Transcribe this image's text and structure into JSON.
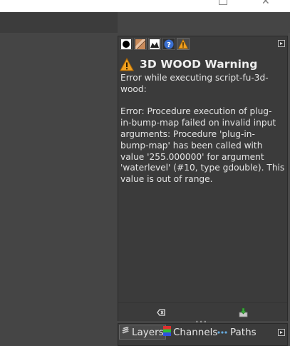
{
  "window": {
    "maximize_icon": "maximize-icon",
    "close_icon": "close-icon"
  },
  "dock": {
    "tabs": [
      {
        "icon": "brush-icon",
        "active": false
      },
      {
        "icon": "pattern-icon",
        "active": false
      },
      {
        "icon": "gradient-icon",
        "active": false
      },
      {
        "icon": "help-icon",
        "active": false
      },
      {
        "icon": "warning-icon",
        "active": true
      }
    ],
    "accent": "#f0a020"
  },
  "error_console": {
    "title": "3D WOOD Warning",
    "message": "Error while executing script-fu-3d-\nwood:\n\nError: Procedure execution of plug-\nin-bump-map failed on invalid input\narguments: Procedure 'plug-in-\nbump-map' has been called with\nvalue '255.000000' for argument\n'waterlevel' (#10, type gdouble). This\nvalue is out of range."
  },
  "bottom_buttons": [
    {
      "icon": "clear-errors-icon"
    },
    {
      "icon": "save-errors-icon"
    }
  ],
  "lower_tabs": [
    {
      "label": "Layers",
      "icon": "layers-icon",
      "active": true
    },
    {
      "label": "Channels",
      "icon": "channels-icon",
      "active": false
    },
    {
      "label": "Paths",
      "icon": "paths-icon",
      "active": false
    }
  ]
}
